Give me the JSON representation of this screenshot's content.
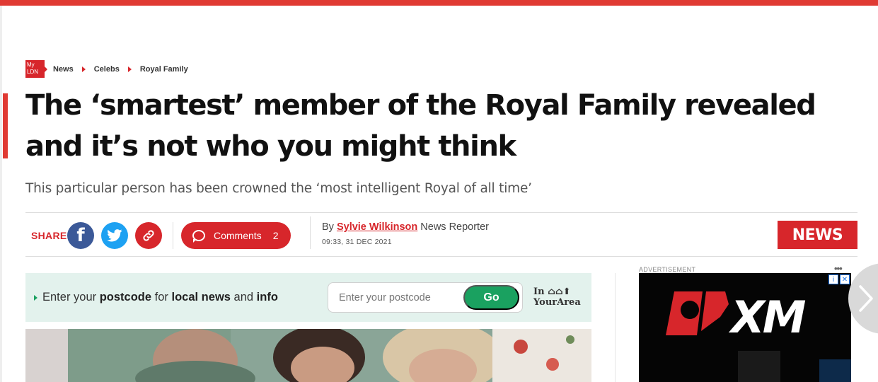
{
  "logo": {
    "line1": "My",
    "line2": "LDN"
  },
  "breadcrumb": [
    "News",
    "Celebs",
    "Royal Family"
  ],
  "headline": "The ‘smartest’ member of the Royal Family revealed and it’s not who you might think",
  "standfirst": "This particular person has been crowned the ‘most intelligent Royal of all time’",
  "share": {
    "label": "SHARE",
    "facebook_glyph": "f",
    "icons": [
      "facebook-icon",
      "twitter-icon",
      "link-icon"
    ]
  },
  "comments": {
    "label": "Comments",
    "count": "2"
  },
  "byline": {
    "prefix": "By",
    "author": "Sylvie Wilkinson",
    "role": "News Reporter",
    "date": "09:33, 31 DEC 2021"
  },
  "section_badge": "NEWS",
  "postcode": {
    "text_1": "Enter your ",
    "bold_1": "postcode",
    "text_2": " for ",
    "bold_2": "local news",
    "text_3": " and ",
    "bold_3": "info",
    "placeholder": "Enter your postcode",
    "button": "Go",
    "brand_line1": "In",
    "brand_line2": "YourArea"
  },
  "ad": {
    "label": "ADVERTISEMENT",
    "menu": "•••",
    "brand": "XM",
    "controls": [
      "i",
      "✕"
    ]
  },
  "colors": {
    "brand_red": "#d7262b",
    "go_green": "#1aa160",
    "panel_green": "#e3f2ed",
    "facebook": "#3b5998",
    "twitter": "#1da1f2"
  }
}
